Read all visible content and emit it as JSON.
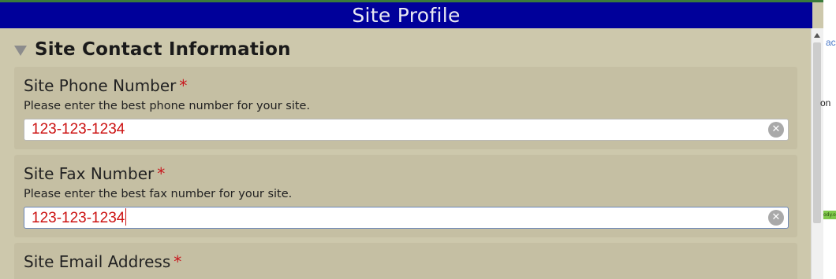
{
  "header": {
    "title": "Site Profile"
  },
  "section": {
    "title": "Site Contact Information"
  },
  "fields": [
    {
      "label": "Site Phone Number",
      "required_mark": "*",
      "help": "Please enter the best phone number for your site.",
      "value": "123-123-1234"
    },
    {
      "label": "Site Fax Number",
      "required_mark": "*",
      "help": "Please enter the best fax number for your site.",
      "value": "123-123-1234"
    },
    {
      "label": "Site Email Address",
      "required_mark": "*"
    }
  ],
  "side_pane": {
    "text_top": "ac",
    "text_mid": "on",
    "tag": "ody.o"
  },
  "colors": {
    "title_bar": "#00009a",
    "panel_bg": "#cdc8ac",
    "field_bg": "#c5bfa3",
    "required": "#c8161d",
    "input_text": "#cc1111"
  }
}
